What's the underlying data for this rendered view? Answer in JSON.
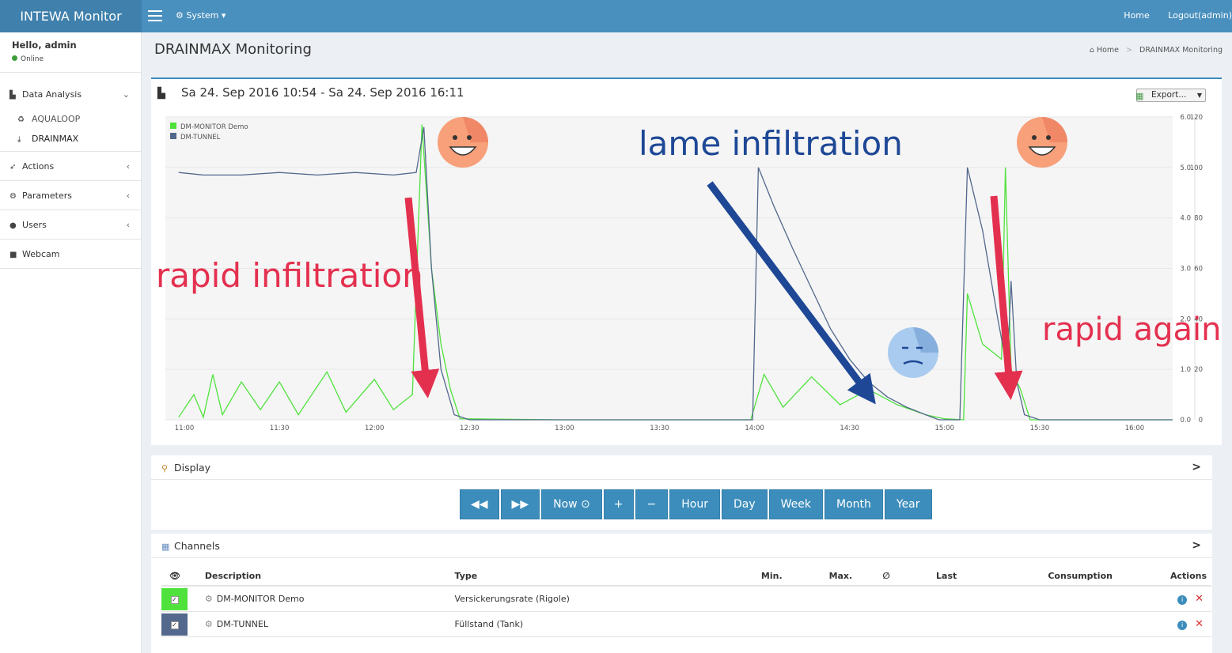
{
  "app": {
    "title": "INTEWA Monitor"
  },
  "topbar": {
    "system_label": "System ▾",
    "home_label": "Home",
    "logout_label": "Logout(admin)"
  },
  "user": {
    "greeting": "Hello, admin",
    "status": "Online"
  },
  "sidebar": {
    "items": [
      {
        "label": "Data Analysis",
        "icon": "area-chart-icon",
        "chevron": "⌄"
      },
      {
        "label": "Actions",
        "icon": "rocket-icon",
        "chevron": "‹"
      },
      {
        "label": "Parameters",
        "icon": "gear-icon",
        "chevron": "‹"
      },
      {
        "label": "Users",
        "icon": "user-icon",
        "chevron": "‹"
      },
      {
        "label": "Webcam",
        "icon": "video-camera-icon"
      }
    ],
    "subitems": [
      {
        "label": "AQUALOOP",
        "icon": "recycle-icon"
      },
      {
        "label": "DRAINMAX",
        "icon": "download-icon"
      }
    ]
  },
  "page": {
    "title": "DRAINMAX Monitoring",
    "breadcrumb_home": "Home",
    "breadcrumb_current": "DRAINMAX Monitoring"
  },
  "chart": {
    "range_title": "Sa 24. Sep 2016 10:54 - Sa 24. Sep 2016 16:11",
    "export_label": "Export...",
    "annotations": {
      "rapid": "rapid infiltration",
      "lame": "lame infiltration",
      "again": "rapid again..."
    }
  },
  "chart_data": {
    "type": "line",
    "x_ticks": [
      "11:00",
      "11:30",
      "12:00",
      "12:30",
      "13:00",
      "13:30",
      "14:00",
      "14:30",
      "15:00",
      "15:30",
      "16:00"
    ],
    "y_left_ticks": [
      "0.0",
      "1.0",
      "2.0",
      "3.0",
      "4.0",
      "5.0",
      "6.0"
    ],
    "y_right_ticks": [
      "0",
      "20",
      "40",
      "60",
      "80",
      "100",
      "120"
    ],
    "ylim_left": [
      0,
      6
    ],
    "ylim_right": [
      0,
      120
    ],
    "legend_position": "top-left",
    "colors": {
      "demo": "#4fe23c",
      "tunnel": "#53688c"
    },
    "series": [
      {
        "name": "DM-MONITOR Demo",
        "points": [
          [
            10.97,
            0.05
          ],
          [
            11.05,
            0.5
          ],
          [
            11.1,
            0.05
          ],
          [
            11.15,
            0.9
          ],
          [
            11.2,
            0.1
          ],
          [
            11.3,
            0.75
          ],
          [
            11.4,
            0.2
          ],
          [
            11.5,
            0.75
          ],
          [
            11.6,
            0.1
          ],
          [
            11.75,
            0.95
          ],
          [
            11.85,
            0.15
          ],
          [
            12.0,
            0.8
          ],
          [
            12.1,
            0.2
          ],
          [
            12.2,
            0.5
          ],
          [
            12.25,
            5.85
          ],
          [
            12.3,
            3.0
          ],
          [
            12.35,
            1.5
          ],
          [
            12.4,
            0.6
          ],
          [
            12.45,
            0.02
          ],
          [
            13.0,
            0.0
          ],
          [
            13.5,
            0.0
          ],
          [
            13.98,
            0.0
          ],
          [
            14.05,
            0.9
          ],
          [
            14.15,
            0.25
          ],
          [
            14.3,
            0.85
          ],
          [
            14.45,
            0.3
          ],
          [
            14.6,
            0.6
          ],
          [
            14.75,
            0.3
          ],
          [
            14.9,
            0.1
          ],
          [
            15.0,
            0.02
          ],
          [
            15.1,
            0.0
          ],
          [
            15.12,
            2.5
          ],
          [
            15.2,
            1.5
          ],
          [
            15.3,
            1.2
          ],
          [
            15.32,
            5.0
          ],
          [
            15.35,
            1.0
          ],
          [
            15.4,
            0.6
          ],
          [
            15.45,
            0.0
          ],
          [
            16.0,
            0.0
          ],
          [
            16.2,
            0.0
          ]
        ]
      },
      {
        "name": "DM-TUNNEL",
        "points": [
          [
            10.97,
            98
          ],
          [
            11.1,
            97
          ],
          [
            11.3,
            97
          ],
          [
            11.5,
            98
          ],
          [
            11.7,
            97
          ],
          [
            11.9,
            98
          ],
          [
            12.1,
            97
          ],
          [
            12.22,
            98
          ],
          [
            12.26,
            116
          ],
          [
            12.3,
            60
          ],
          [
            12.35,
            20
          ],
          [
            12.42,
            2
          ],
          [
            12.5,
            0
          ],
          [
            13.0,
            0
          ],
          [
            13.5,
            0
          ],
          [
            13.99,
            0
          ],
          [
            14.02,
            100
          ],
          [
            14.1,
            85
          ],
          [
            14.2,
            68
          ],
          [
            14.3,
            52
          ],
          [
            14.4,
            36
          ],
          [
            14.5,
            24
          ],
          [
            14.6,
            15
          ],
          [
            14.7,
            9
          ],
          [
            14.8,
            5
          ],
          [
            14.9,
            2
          ],
          [
            14.97,
            0
          ],
          [
            15.08,
            0
          ],
          [
            15.12,
            100
          ],
          [
            15.2,
            75
          ],
          [
            15.28,
            40
          ],
          [
            15.33,
            20
          ],
          [
            15.35,
            55
          ],
          [
            15.38,
            15
          ],
          [
            15.42,
            2
          ],
          [
            15.5,
            0
          ],
          [
            16.0,
            0
          ],
          [
            16.2,
            0
          ]
        ]
      }
    ]
  },
  "display_panel": {
    "title": "Display",
    "buttons": [
      "◀◀",
      "▶▶",
      "Now ⊙",
      "+",
      "−",
      "Hour",
      "Day",
      "Week",
      "Month",
      "Year"
    ]
  },
  "channels_panel": {
    "title": "Channels",
    "columns": [
      "Description",
      "Type",
      "Min.",
      "Max.",
      "∅",
      "Last",
      "Consumption",
      "Actions"
    ],
    "rows": [
      {
        "description": "DM-MONITOR Demo",
        "type": "Versickerungsrate (Rigole)",
        "color": "#4fe23c"
      },
      {
        "description": "DM-TUNNEL",
        "type": "Füllstand (Tank)",
        "color": "#53688c"
      }
    ]
  }
}
